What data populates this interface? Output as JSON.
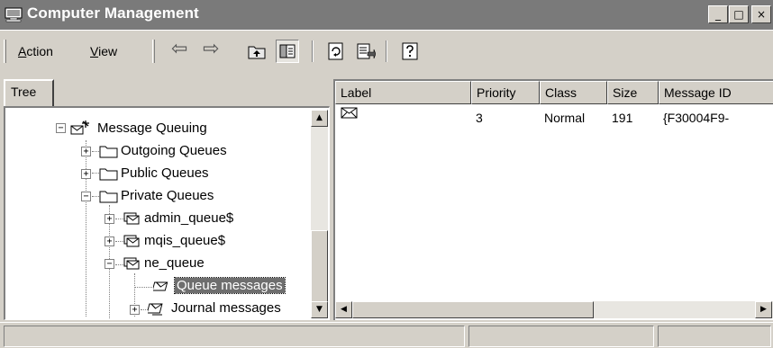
{
  "window": {
    "title": "Computer Management",
    "minimize_glyph": "_",
    "maximize_glyph": "□",
    "close_glyph": "×"
  },
  "menu": {
    "action_prefix": "",
    "action_accel": "A",
    "action_rest": "ction",
    "view_accel": "V",
    "view_rest": "iew"
  },
  "toolbar": {
    "back_glyph": "⇦",
    "forward_glyph": "⇨",
    "icons": [
      "up-one-level-icon",
      "show-hide-tree-icon",
      "refresh-icon",
      "export-list-icon",
      "help-icon"
    ]
  },
  "tree": {
    "tab_label": "Tree",
    "nodes": [
      {
        "label": "Message Queuing",
        "expander": "−",
        "icon": "message-queuing-icon"
      },
      {
        "label": "Outgoing Queues",
        "expander": "+",
        "icon": "folder-icon"
      },
      {
        "label": "Public Queues",
        "expander": "+",
        "icon": "folder-icon"
      },
      {
        "label": "Private Queues",
        "expander": "−",
        "icon": "folder-icon"
      },
      {
        "label": "admin_queue$",
        "expander": "+",
        "icon": "queue-icon"
      },
      {
        "label": "mqis_queue$",
        "expander": "+",
        "icon": "queue-icon"
      },
      {
        "label": "ne_queue",
        "expander": "−",
        "icon": "queue-icon"
      },
      {
        "label": "Queue messages",
        "expander": "",
        "icon": "queue-messages-icon",
        "selected": true
      },
      {
        "label": "Journal messages",
        "expander": "+",
        "icon": "journal-messages-icon"
      }
    ]
  },
  "list": {
    "columns": [
      "Label",
      "Priority",
      "Class",
      "Size",
      "Message ID"
    ],
    "rows": [
      {
        "label": "",
        "icon": "message-envelope-icon",
        "priority": "3",
        "class": "Normal",
        "size": "191",
        "message_id": "{F30004F9-"
      }
    ]
  },
  "colors": {
    "titlebar": "#7a7a7a",
    "face": "#d4d0c8",
    "selection": "#6e6e6e"
  }
}
